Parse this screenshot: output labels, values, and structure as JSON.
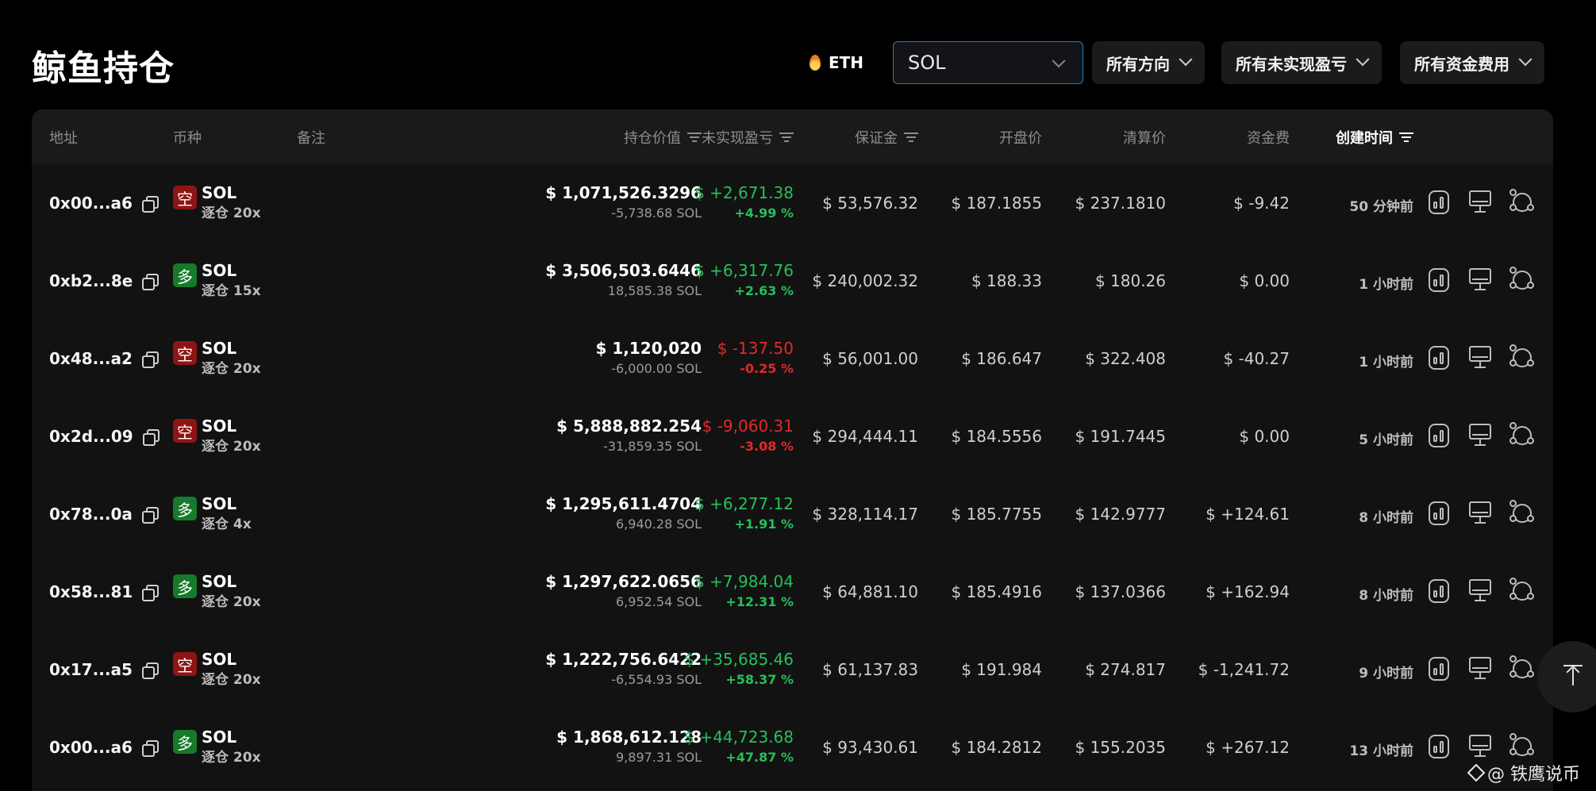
{
  "page": {
    "title": "鲸鱼持仓"
  },
  "filters": {
    "eth_label": "ETH",
    "coin_select": {
      "value": "SOL"
    },
    "direction": "所有方向",
    "unrealized_pnl": "所有未实现盈亏",
    "funding_fee": "所有资金费用"
  },
  "columns": {
    "address": "地址",
    "coin": "币种",
    "note": "备注",
    "position_value": "持仓价值",
    "unrealized_pnl": "未实现盈亏",
    "margin": "保证金",
    "open_price": "开盘价",
    "liq_price": "清算价",
    "funding": "资金费",
    "created": "创建时间"
  },
  "rows": [
    {
      "address": "0x00...a6",
      "side": "空",
      "side_type": "short",
      "coin": "SOL",
      "leverage": "逐仓 20x",
      "value": "$ 1,071,526.3296",
      "size": "-5,738.68 SOL",
      "pnl": "$ +2,671.38",
      "pnl_pct": "+4.99 %",
      "pnl_dir": "green",
      "margin": "$ 53,576.32",
      "open": "$ 187.1855",
      "liq": "$ 237.1810",
      "funding": "$ -9.42",
      "funding_dir": "red",
      "created": "50 分钟前"
    },
    {
      "address": "0xb2...8e",
      "side": "多",
      "side_type": "long",
      "coin": "SOL",
      "leverage": "逐仓 15x",
      "value": "$ 3,506,503.6446",
      "size": "18,585.38 SOL",
      "pnl": "$ +6,317.76",
      "pnl_pct": "+2.63 %",
      "pnl_dir": "green",
      "margin": "$ 240,002.32",
      "open": "$ 188.33",
      "liq": "$ 180.26",
      "funding": "$ 0.00",
      "funding_dir": "neutral",
      "created": "1 小时前"
    },
    {
      "address": "0x48...a2",
      "side": "空",
      "side_type": "short",
      "coin": "SOL",
      "leverage": "逐仓 20x",
      "value": "$ 1,120,020",
      "size": "-6,000.00 SOL",
      "pnl": "$ -137.50",
      "pnl_pct": "-0.25 %",
      "pnl_dir": "red",
      "margin": "$ 56,001.00",
      "open": "$ 186.647",
      "liq": "$ 322.408",
      "funding": "$ -40.27",
      "funding_dir": "red",
      "created": "1 小时前"
    },
    {
      "address": "0x2d...09",
      "side": "空",
      "side_type": "short",
      "coin": "SOL",
      "leverage": "逐仓 20x",
      "value": "$ 5,888,882.254",
      "size": "-31,859.35 SOL",
      "pnl": "$ -9,060.31",
      "pnl_pct": "-3.08 %",
      "pnl_dir": "red",
      "margin": "$ 294,444.11",
      "open": "$ 184.5556",
      "liq": "$ 191.7445",
      "funding": "$ 0.00",
      "funding_dir": "neutral",
      "created": "5 小时前"
    },
    {
      "address": "0x78...0a",
      "side": "多",
      "side_type": "long",
      "coin": "SOL",
      "leverage": "逐仓 4x",
      "value": "$ 1,295,611.4704",
      "size": "6,940.28 SOL",
      "pnl": "$ +6,277.12",
      "pnl_pct": "+1.91 %",
      "pnl_dir": "green",
      "margin": "$ 328,114.17",
      "open": "$ 185.7755",
      "liq": "$ 142.9777",
      "funding": "$ +124.61",
      "funding_dir": "green",
      "created": "8 小时前"
    },
    {
      "address": "0x58...81",
      "side": "多",
      "side_type": "long",
      "coin": "SOL",
      "leverage": "逐仓 20x",
      "value": "$ 1,297,622.0656",
      "size": "6,952.54 SOL",
      "pnl": "$ +7,984.04",
      "pnl_pct": "+12.31 %",
      "pnl_dir": "green",
      "margin": "$ 64,881.10",
      "open": "$ 185.4916",
      "liq": "$ 137.0366",
      "funding": "$ +162.94",
      "funding_dir": "green",
      "created": "8 小时前"
    },
    {
      "address": "0x17...a5",
      "side": "空",
      "side_type": "short",
      "coin": "SOL",
      "leverage": "逐仓 20x",
      "value": "$ 1,222,756.6422",
      "size": "-6,554.93 SOL",
      "pnl": "$ +35,685.46",
      "pnl_pct": "+58.37 %",
      "pnl_dir": "green",
      "margin": "$ 61,137.83",
      "open": "$ 191.984",
      "liq": "$ 274.817",
      "funding": "$ -1,241.72",
      "funding_dir": "red",
      "created": "9 小时前"
    },
    {
      "address": "0x00...a6",
      "side": "多",
      "side_type": "long",
      "coin": "SOL",
      "leverage": "逐仓 20x",
      "value": "$ 1,868,612.128",
      "size": "9,897.31 SOL",
      "pnl": "$ +44,723.68",
      "pnl_pct": "+47.87 %",
      "pnl_dir": "green",
      "margin": "$ 93,430.61",
      "open": "$ 184.2812",
      "liq": "$ 155.2035",
      "funding": "$ +267.12",
      "funding_dir": "green",
      "created": "13 小时前"
    }
  ],
  "watermark": "@ 铁鹰说币",
  "colors": {
    "positive": "#25c05a",
    "negative": "#e02a2a",
    "short_badge": "#8e1414",
    "long_badge": "#167a2b",
    "select_border": "#2a7fa6"
  }
}
